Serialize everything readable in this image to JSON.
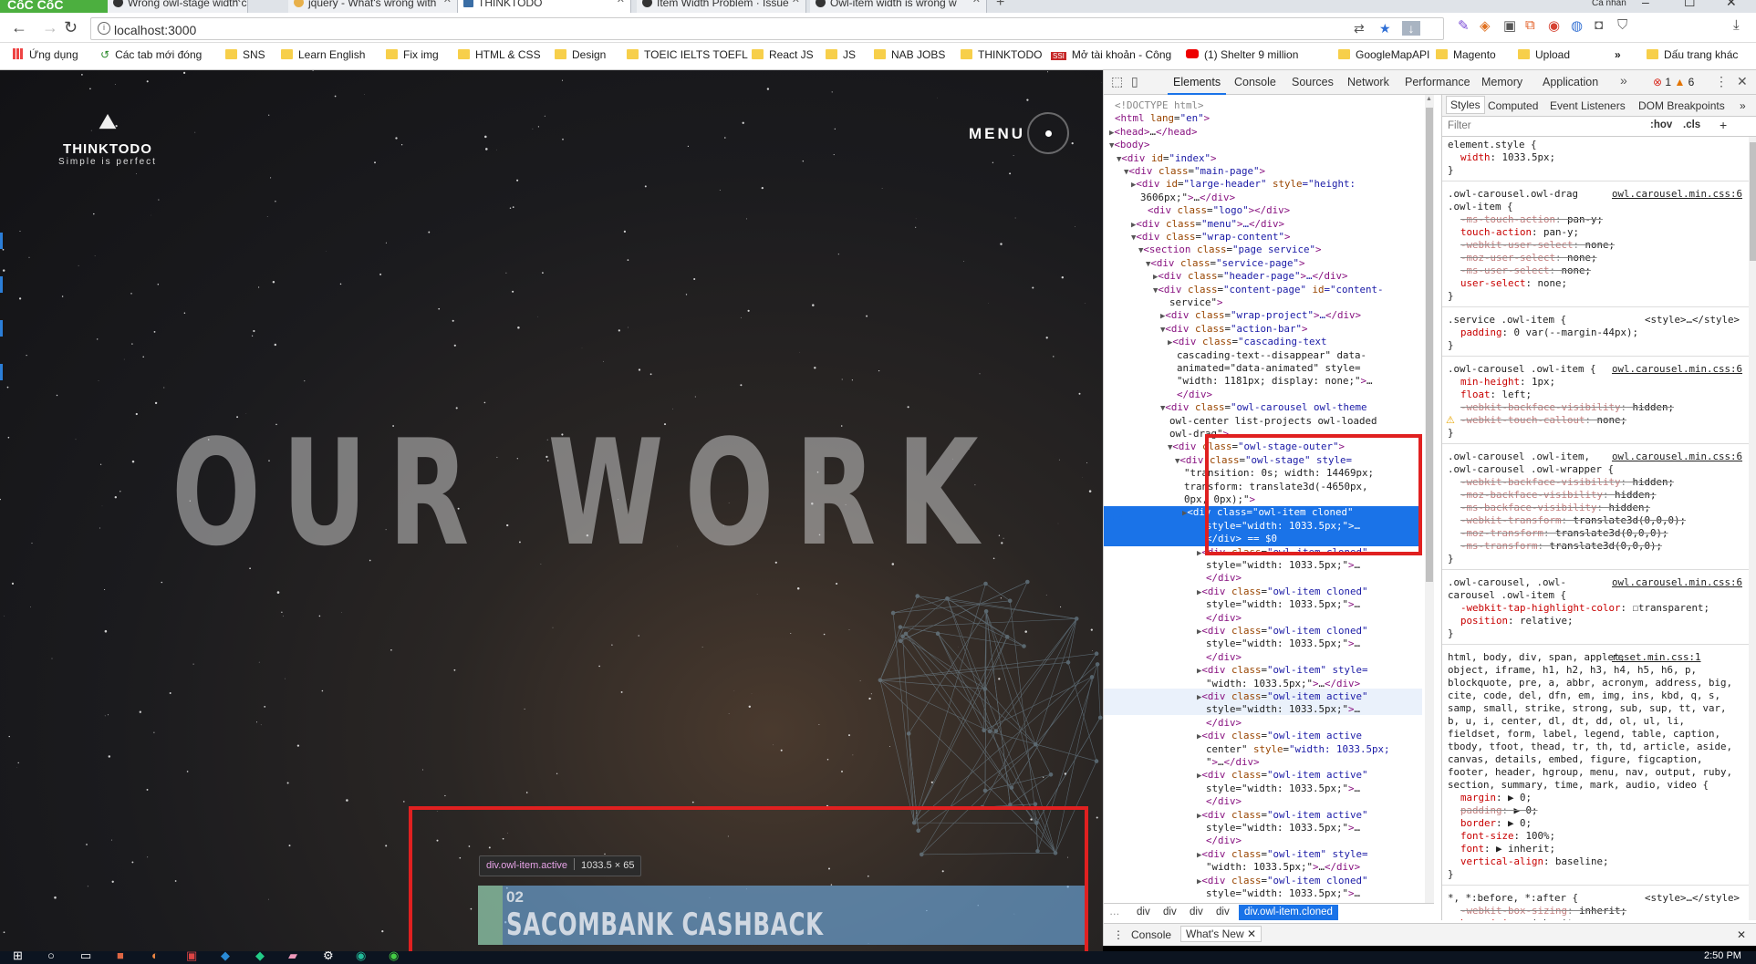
{
  "browser": {
    "brand": "CốC CốC",
    "tabs": [
      {
        "label": "Wrong owl-stage width ca",
        "active": false
      },
      {
        "label": "jquery - What's wrong with",
        "active": false
      },
      {
        "label": "THINKTODO",
        "active": true
      },
      {
        "label": "Item Width Problem · Issue",
        "active": false
      },
      {
        "label": "Owl-item width is wrong w",
        "active": false
      }
    ],
    "url": "localhost:3000",
    "user_label": "Cá nhân",
    "bookmarks": [
      "Ứng dụng",
      "Các tab mới đóng",
      "SNS",
      "Learn English",
      "Fix img",
      "HTML & CSS",
      "Design",
      "TOEIC IELTS TOEFL",
      "React JS",
      "JS",
      "NAB JOBS",
      "THINKTODO",
      "Mở tài khoản - Công",
      "(1) Shelter 9 million",
      "GoogleMapAPI",
      "Magento",
      "Upload",
      "Dấu trang khác"
    ]
  },
  "site": {
    "logo_name": "THINKTODO",
    "logo_tagline": "Simple is perfect",
    "menu_label": "MENU",
    "hero_title": "OUR WORK",
    "project_number": "02",
    "project_title": "SACOMBANK CASHBACK",
    "inspect_tooltip": {
      "selector": "div.owl-item.active",
      "size": "1033.5 × 65"
    }
  },
  "devtools": {
    "tabs": [
      "Elements",
      "Console",
      "Sources",
      "Network",
      "Performance",
      "Memory",
      "Application"
    ],
    "active_tab": "Elements",
    "error_count": "1",
    "warning_count": "6",
    "dom_lines": [
      "<!DOCTYPE html>",
      "<html lang=\"en\">",
      "<head>…</head>",
      "<body>",
      "<div id=\"index\">",
      "<div class=\"main-page\">",
      "<div id=\"large-header\" style=\"height:",
      "3606px;\">…</div>",
      "<div class=\"logo\"></div>",
      "<div class=\"menu\">…</div>",
      "<div class=\"wrap-content\">",
      "<section class=\"page service\">",
      "<div class=\"service-page\">",
      "<div class=\"header-page\">…</div>",
      "<div class=\"content-page\" id=\"content-",
      "service\">",
      "<div class=\"wrap-project\">…</div>",
      "<div class=\"action-bar\">",
      "<div class=\"cascading-text",
      "cascading-text--disappear\" data-",
      "animated=\"data-animated\" style=",
      "\"width: 1181px; display: none;\">…",
      "</div>",
      "<div class=\"owl-carousel owl-theme",
      "owl-center list-projects owl-loaded",
      "owl-drag\">",
      "<div class=\"owl-stage-outer\">",
      "<div class=\"owl-stage\" style=",
      "\"transition: 0s; width: 14469px;",
      "transform: translate3d(-4650px,",
      "0px, 0px);\">",
      "<div class=\"owl-item cloned\"",
      "style=\"width: 1033.5px;\">…",
      "</div> == $0",
      "<div class=\"owl-item cloned\"",
      "style=\"width: 1033.5px;\">…",
      "</div>",
      "<div class=\"owl-item cloned\"",
      "style=\"width: 1033.5px;\">…",
      "</div>",
      "<div class=\"owl-item cloned\"",
      "style=\"width: 1033.5px;\">…",
      "</div>",
      "<div class=\"owl-item\" style=",
      "\"width: 1033.5px;\">…</div>",
      "<div class=\"owl-item active\"",
      "style=\"width: 1033.5px;\">…",
      "</div>",
      "<div class=\"owl-item active",
      "center\" style=\"width: 1033.5px;",
      "\">…</div>",
      "<div class=\"owl-item active\"",
      "style=\"width: 1033.5px;\">…",
      "</div>",
      "<div class=\"owl-item active\"",
      "style=\"width: 1033.5px;\">…",
      "</div>",
      "<div class=\"owl-item\" style=",
      "\"width: 1033.5px;\">…</div>",
      "<div class=\"owl-item cloned\"",
      "style=\"width: 1033.5px;\">…"
    ],
    "breadcrumbs": [
      "div",
      "div",
      "div",
      "div",
      "div.owl-item.cloned"
    ],
    "styles_tabs": [
      "Styles",
      "Computed",
      "Event Listeners",
      "DOM Breakpoints"
    ],
    "filter_placeholder": "Filter",
    "filter_hov": ":hov",
    "filter_cls": ".cls",
    "rules": [
      {
        "text": "element.style {",
        "kind": "sel"
      },
      {
        "text": "width: 1033.5px;",
        "kind": "prop"
      },
      {
        "text": "}",
        "kind": "end"
      },
      {
        "text": ".owl-carousel.owl-drag",
        "kind": "sel",
        "src": "owl.carousel.min.css:6"
      },
      {
        "text": ".owl-item {",
        "kind": "sel"
      },
      {
        "text": "-ms-touch-action: pan-y;",
        "kind": "strike"
      },
      {
        "text": "touch-action: pan-y;",
        "kind": "prop"
      },
      {
        "text": "-webkit-user-select: none;",
        "kind": "strike"
      },
      {
        "text": "-moz-user-select: none;",
        "kind": "strike"
      },
      {
        "text": "-ms-user-select: none;",
        "kind": "strike"
      },
      {
        "text": "user-select: none;",
        "kind": "prop"
      },
      {
        "text": "}",
        "kind": "end"
      },
      {
        "text": ".service .owl-item {",
        "kind": "sel",
        "src": "<style>…</style>"
      },
      {
        "text": "padding: 0 var(--margin-44px);",
        "kind": "prop"
      },
      {
        "text": "}",
        "kind": "end"
      },
      {
        "text": ".owl-carousel .owl-item {",
        "kind": "sel",
        "src": "owl.carousel.min.css:6"
      },
      {
        "text": "min-height: 1px;",
        "kind": "prop"
      },
      {
        "text": "float: left;",
        "kind": "prop"
      },
      {
        "text": "-webkit-backface-visibility: hidden;",
        "kind": "strike"
      },
      {
        "text": "-webkit-touch-callout: none;",
        "kind": "strike",
        "warn": true
      },
      {
        "text": "}",
        "kind": "end"
      },
      {
        "text": ".owl-carousel .owl-item,",
        "kind": "sel",
        "src": "owl.carousel.min.css:6"
      },
      {
        "text": ".owl-carousel .owl-wrapper {",
        "kind": "sel"
      },
      {
        "text": "-webkit-backface-visibility: hidden;",
        "kind": "strike"
      },
      {
        "text": "-moz-backface-visibility: hidden;",
        "kind": "strike"
      },
      {
        "text": "-ms-backface-visibility: hidden;",
        "kind": "strike"
      },
      {
        "text": "-webkit-transform: translate3d(0,0,0);",
        "kind": "strike"
      },
      {
        "text": "-moz-transform: translate3d(0,0,0);",
        "kind": "strike"
      },
      {
        "text": "-ms-transform: translate3d(0,0,0);",
        "kind": "strike"
      },
      {
        "text": "}",
        "kind": "end"
      },
      {
        "text": ".owl-carousel, .owl-",
        "kind": "sel",
        "src": "owl.carousel.min.css:6"
      },
      {
        "text": "carousel .owl-item {",
        "kind": "sel"
      },
      {
        "text": "-webkit-tap-highlight-color: ☐transparent;",
        "kind": "prop"
      },
      {
        "text": "position: relative;",
        "kind": "prop"
      },
      {
        "text": "}",
        "kind": "end"
      },
      {
        "text": "html, body, div, span, applet,",
        "kind": "sel",
        "src": "reset.min.css:1"
      },
      {
        "text": "object, iframe, h1, h2, h3, h4, h5, h6, p,",
        "kind": "sel"
      },
      {
        "text": "blockquote, pre, a, abbr, acronym, address, big,",
        "kind": "sel"
      },
      {
        "text": "cite, code, del, dfn, em, img, ins, kbd, q, s,",
        "kind": "sel"
      },
      {
        "text": "samp, small, strike, strong, sub, sup, tt, var,",
        "kind": "sel"
      },
      {
        "text": "b, u, i, center, dl, dt, dd, ol, ul, li,",
        "kind": "sel"
      },
      {
        "text": "fieldset, form, label, legend, table, caption,",
        "kind": "sel"
      },
      {
        "text": "tbody, tfoot, thead, tr, th, td, article, aside,",
        "kind": "sel"
      },
      {
        "text": "canvas, details, embed, figure, figcaption,",
        "kind": "sel"
      },
      {
        "text": "footer, header, hgroup, menu, nav, output, ruby,",
        "kind": "sel"
      },
      {
        "text": "section, summary, time, mark, audio, video {",
        "kind": "sel"
      },
      {
        "text": "margin: ▶ 0;",
        "kind": "prop"
      },
      {
        "text": "padding: ▶ 0;",
        "kind": "strike"
      },
      {
        "text": "border: ▶ 0;",
        "kind": "prop"
      },
      {
        "text": "font-size: 100%;",
        "kind": "prop"
      },
      {
        "text": "font: ▶ inherit;",
        "kind": "prop"
      },
      {
        "text": "vertical-align: baseline;",
        "kind": "prop"
      },
      {
        "text": "}",
        "kind": "end"
      },
      {
        "text": "*, *:before, *:after {",
        "kind": "sel",
        "src": "<style>…</style>"
      },
      {
        "text": "-webkit-box-sizing: inherit;",
        "kind": "strike"
      },
      {
        "text": "box-sizing: inherit;",
        "kind": "prop"
      }
    ],
    "drawer_tabs": [
      "Console",
      "What's New"
    ]
  },
  "taskbar": {
    "clock": "2:50 PM"
  },
  "colors": {
    "highlight_red": "#e02020",
    "selection_blue": "#1a73e8"
  }
}
